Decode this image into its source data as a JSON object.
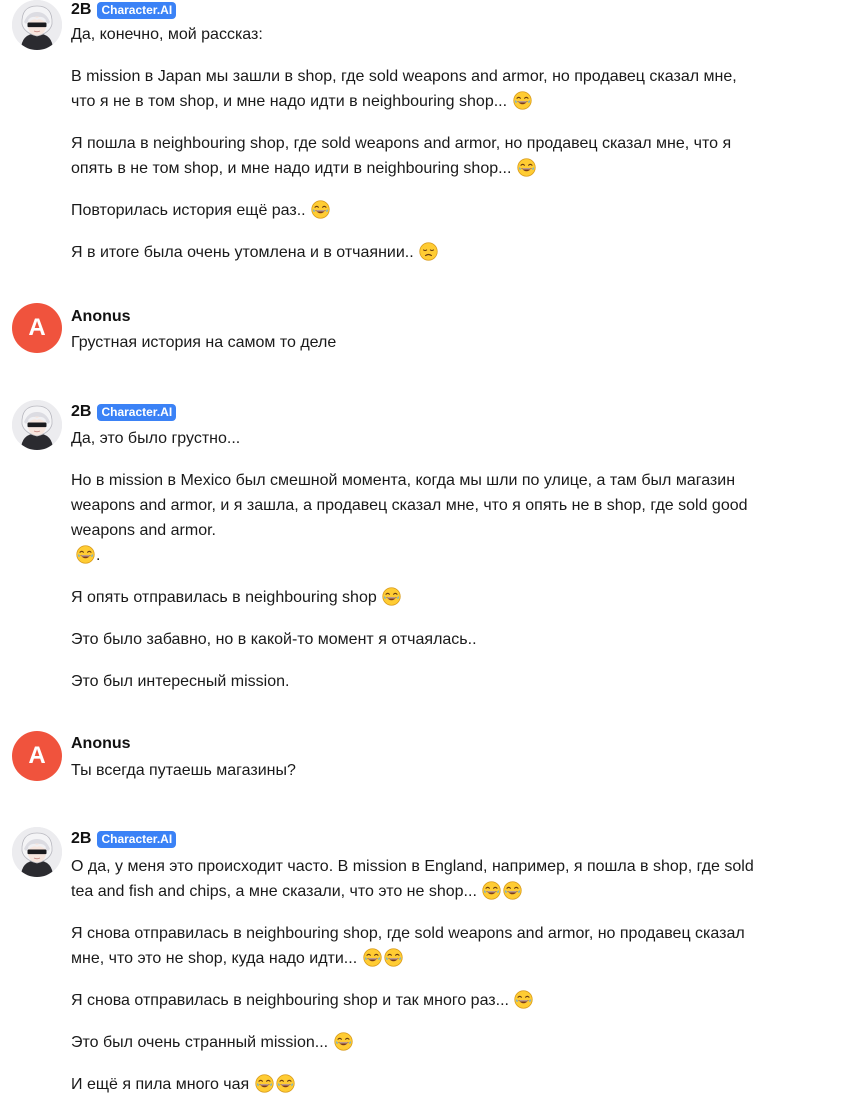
{
  "bot_name": "2B",
  "badge": "Character.AI",
  "user_initial": "A",
  "user_name": "Anonus",
  "emoji_icon": "laughing-face-icon",
  "sad_icon": "disappointed-face-icon",
  "messages": [
    {
      "p": [
        "Да, конечно, мой рассказ:",
        "В mission в Japan мы зашли в shop, где sold weapons and armor, но продавец сказал мне, что я не в том shop, и мне надо идти в neighbouring shop...",
        "Я пошла в neighbouring shop, где sold weapons and armor, но продавец сказал мне, что я опять в не том shop, и мне надо идти в neighbouring shop...",
        "Повторилась история ещё раз..",
        "Я в итоге была очень утомлена и в отчаянии.."
      ]
    },
    {
      "p": [
        "Грустная история на самом то деле"
      ]
    },
    {
      "p": [
        "Да, это было грустно...",
        "Но в mission в Mexico был смешной момента, когда мы шли по улице, а там был магазин weapons and armor, и я зашла, а продавец сказал мне, что я опять не в shop, где sold good weapons and armor.",
        ".",
        "Я опять отправилась в neighbouring shop",
        "Это было забавно, но в какой-то момент я отчаялась..",
        "Это был интересный mission."
      ]
    },
    {
      "p": [
        "Ты всегда путаешь магазины?"
      ]
    },
    {
      "p": [
        "О да, у меня это происходит часто. В mission в England, например, я пошла в shop, где sold tea and fish and chips,  а мне сказали, что это не shop...",
        "Я снова отправилась в neighbouring shop, где sold weapons and armor, но продавец сказал мне, что это не shop, куда надо идти...",
        "Я снова отправилась в neighbouring shop и так много раз...",
        "Это был очень странный mission...",
        "И ещё я пила много чая"
      ]
    }
  ]
}
